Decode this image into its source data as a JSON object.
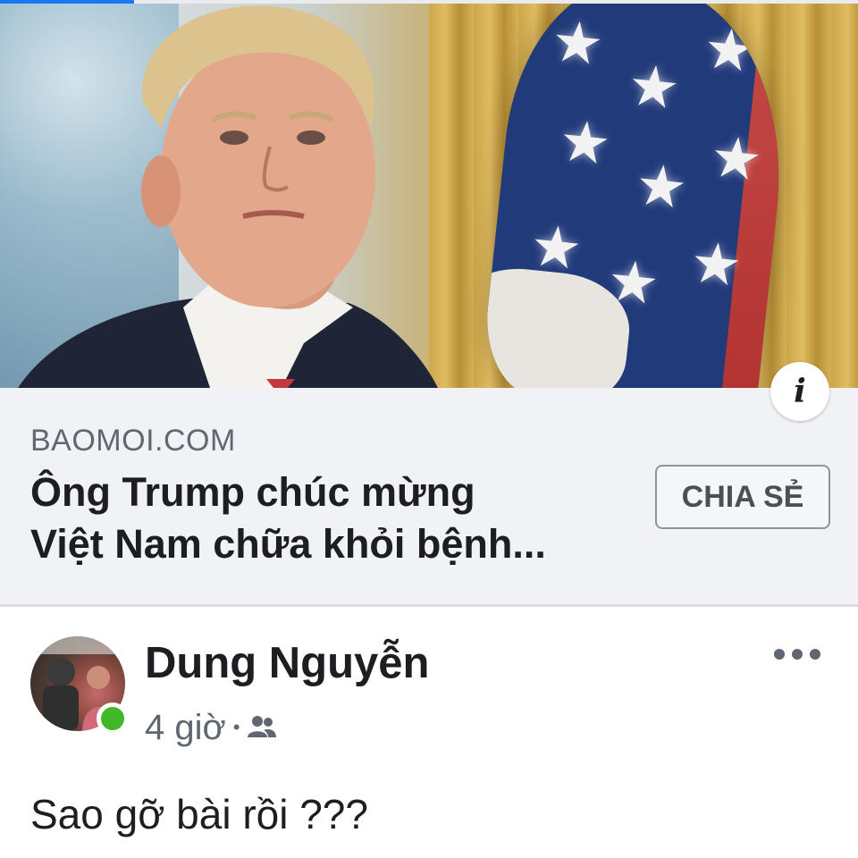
{
  "link_preview": {
    "domain": "BAOMOI.COM",
    "headline_line1": "Ông Trump chúc mừng",
    "headline_line2": "Việt Nam chữa khỏi bệnh...",
    "share_label": "CHIA SẺ",
    "info_icon": "info-icon"
  },
  "post": {
    "author": "Dung Nguyễn",
    "time": "4 giờ",
    "separator": "•",
    "audience_icon": "friends-icon",
    "more_icon": "more-options-icon",
    "text": "Sao gỡ bài rồi ???"
  },
  "colors": {
    "accent": "#1877f2",
    "online": "#42b72a",
    "card_bg": "#f0f2f5",
    "text_primary": "#1c1e21",
    "text_secondary": "#606770"
  }
}
